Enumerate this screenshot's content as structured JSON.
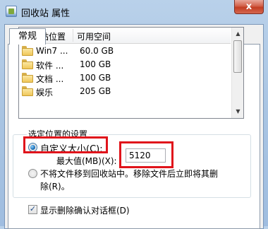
{
  "window": {
    "title": "回收站 属性",
    "close_glyph": "x"
  },
  "tabs": [
    {
      "label": "常规"
    }
  ],
  "recycle_list": {
    "columns": [
      "回收站位置",
      "可用空间"
    ],
    "rows": [
      {
        "location": "Win7 ...",
        "space": "60.0 GB"
      },
      {
        "location": "软件 ...",
        "space": "100 GB"
      },
      {
        "location": "文档 ...",
        "space": "100 GB"
      },
      {
        "location": "娱乐",
        "space": "205 GB"
      }
    ]
  },
  "settings": {
    "group_label": "选定位置的设置",
    "custom_size_label": "自定义大小(C):",
    "max_size_label": "最大值(MB)(X):",
    "max_size_value": "5120",
    "no_recycle_line1": "不将文件移到回收站中。移除文件后立即将其删",
    "no_recycle_line2": "除(R)。",
    "custom_selected": true
  },
  "confirm_delete": {
    "label": "显示删除确认对话框(D)",
    "checked": true,
    "check_glyph": "✓"
  },
  "colors": {
    "highlight": "#e0141b"
  }
}
